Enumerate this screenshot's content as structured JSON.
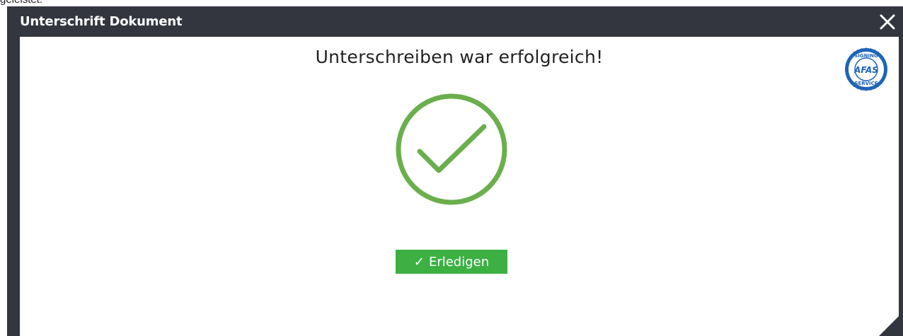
{
  "background_caption": "geleistet.",
  "dialog": {
    "title": "Unterschrift Dokument",
    "close_icon": "close-icon",
    "headline": "Unterschreiben war erfolgreich!",
    "seal": {
      "icon": "afas-signing-service-seal",
      "brand": "AFAS",
      "ring_text_top": "SIGNING",
      "ring_text_bottom": "SERVICE"
    },
    "success_icon": "checkmark-circle-icon",
    "done_button": {
      "icon": "✓",
      "label": "Erledigen"
    }
  },
  "colors": {
    "titlebar": "#33363f",
    "success_green": "#6aaf4c",
    "button_green": "#3cb043",
    "seal_blue": "#1f64b8"
  }
}
